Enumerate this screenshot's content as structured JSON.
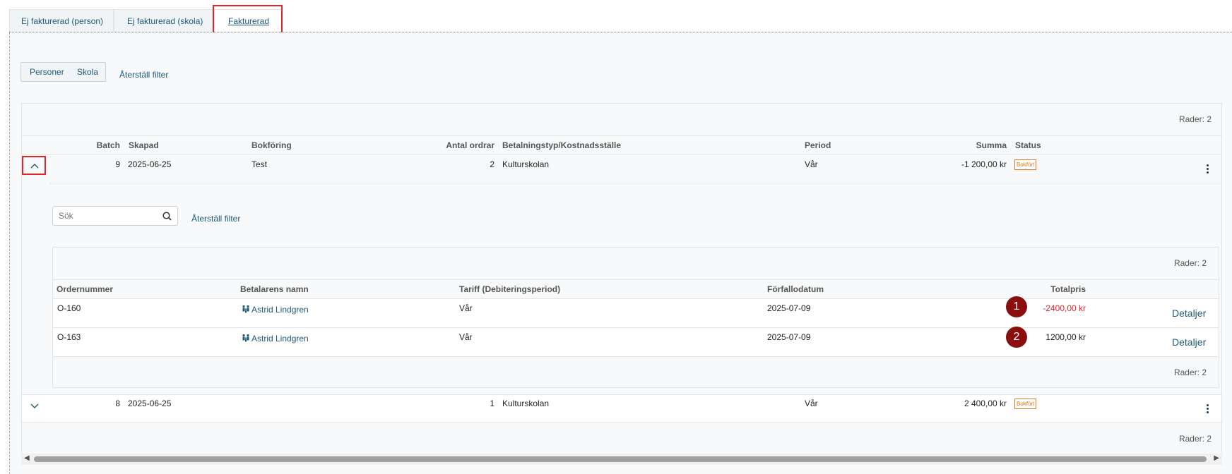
{
  "tabs": [
    {
      "label": "Ej fakturerad (person)"
    },
    {
      "label": "Ej fakturerad (skola)"
    },
    {
      "label": "Fakturerad"
    }
  ],
  "filters": {
    "toggle_persons": "Personer",
    "toggle_school": "Skola",
    "reset": "Återställ filter"
  },
  "batch_table": {
    "row_count": "Rader: 2",
    "headers": {
      "batch": "Batch",
      "created": "Skapad",
      "booking": "Bokföring",
      "orders": "Antal ordrar",
      "payment": "Betalningstyp/Kostnadsställe",
      "period": "Period",
      "sum": "Summa",
      "status": "Status"
    },
    "rows": [
      {
        "batch": "9",
        "created": "2025-06-25",
        "booking": "Test",
        "orders": "2",
        "payment": "Kulturskolan",
        "period": "Vår",
        "sum": "-1 200,00 kr",
        "status": "Bokfört"
      },
      {
        "batch": "8",
        "created": "2025-06-25",
        "booking": "",
        "orders": "1",
        "payment": "Kulturskolan",
        "period": "Vår",
        "sum": "2 400,00 kr",
        "status": "Bokfört"
      }
    ]
  },
  "details": {
    "search_placeholder": "Sök",
    "reset": "Återställ filter",
    "row_count": "Rader: 2",
    "headers": {
      "order": "Ordernummer",
      "payer": "Betalarens namn",
      "tariff": "Tariff (Debiteringsperiod)",
      "due": "Förfallodatum",
      "total": "Totalpris"
    },
    "rows": [
      {
        "order": "O-160",
        "payer": "Astrid Lindgren",
        "tariff": "Vår",
        "due": "2025-07-09",
        "total": "-2400,00 kr",
        "marker": "1",
        "action": "Detaljer"
      },
      {
        "order": "O-163",
        "payer": "Astrid Lindgren",
        "tariff": "Vår",
        "due": "2025-07-09",
        "total": "1200,00 kr",
        "marker": "2",
        "action": "Detaljer"
      }
    ]
  },
  "colors": {
    "link": "#1e5a78",
    "negative": "#e0262c",
    "badge": "#e07a1f",
    "highlight": "#e0262c",
    "marker": "#8b0e0e"
  }
}
